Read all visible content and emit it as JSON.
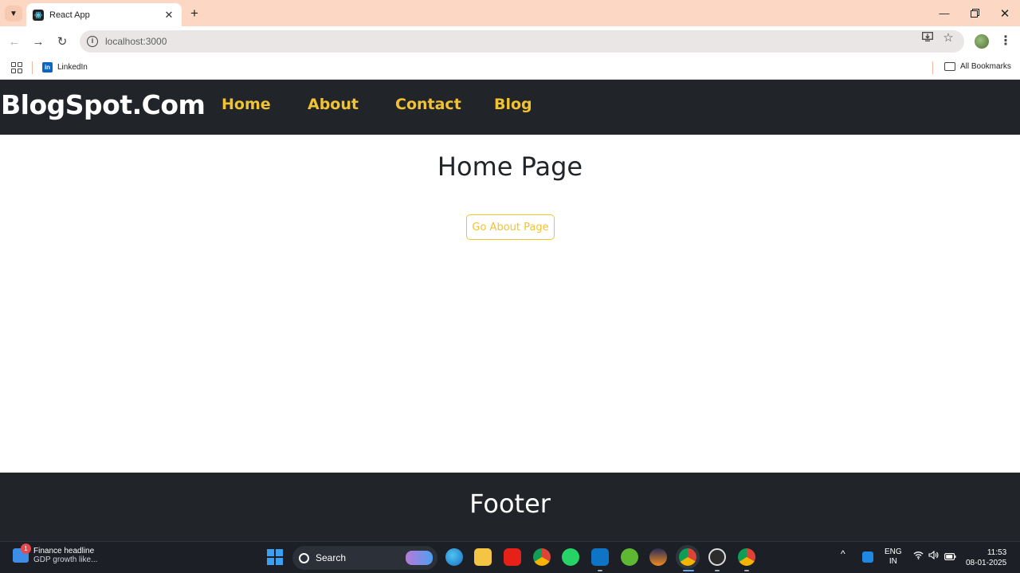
{
  "browser": {
    "tab_title": "React App",
    "new_tab_symbol": "+",
    "url": "localhost:3000",
    "bookmarks": [
      {
        "label": "LinkedIn"
      }
    ],
    "all_bookmarks_label": "All Bookmarks"
  },
  "site": {
    "brand": "BlogSpot.Com",
    "nav": [
      {
        "label": "Home"
      },
      {
        "label": "About"
      },
      {
        "label": "Contact"
      },
      {
        "label": "Blog"
      }
    ],
    "heading": "Home Page",
    "button_label": "Go About Page",
    "footer_title": "Footer"
  },
  "taskbar": {
    "news_badge": "1",
    "news_headline": "Finance headline",
    "news_sub": "GDP growth like...",
    "search_label": "Search",
    "lang_line1": "ENG",
    "lang_line2": "IN",
    "time": "11:53",
    "date": "08-01-2025"
  },
  "colors": {
    "navbar_bg": "#212529",
    "nav_link": "#f1c232",
    "titlebar": "#fbd7c4"
  }
}
